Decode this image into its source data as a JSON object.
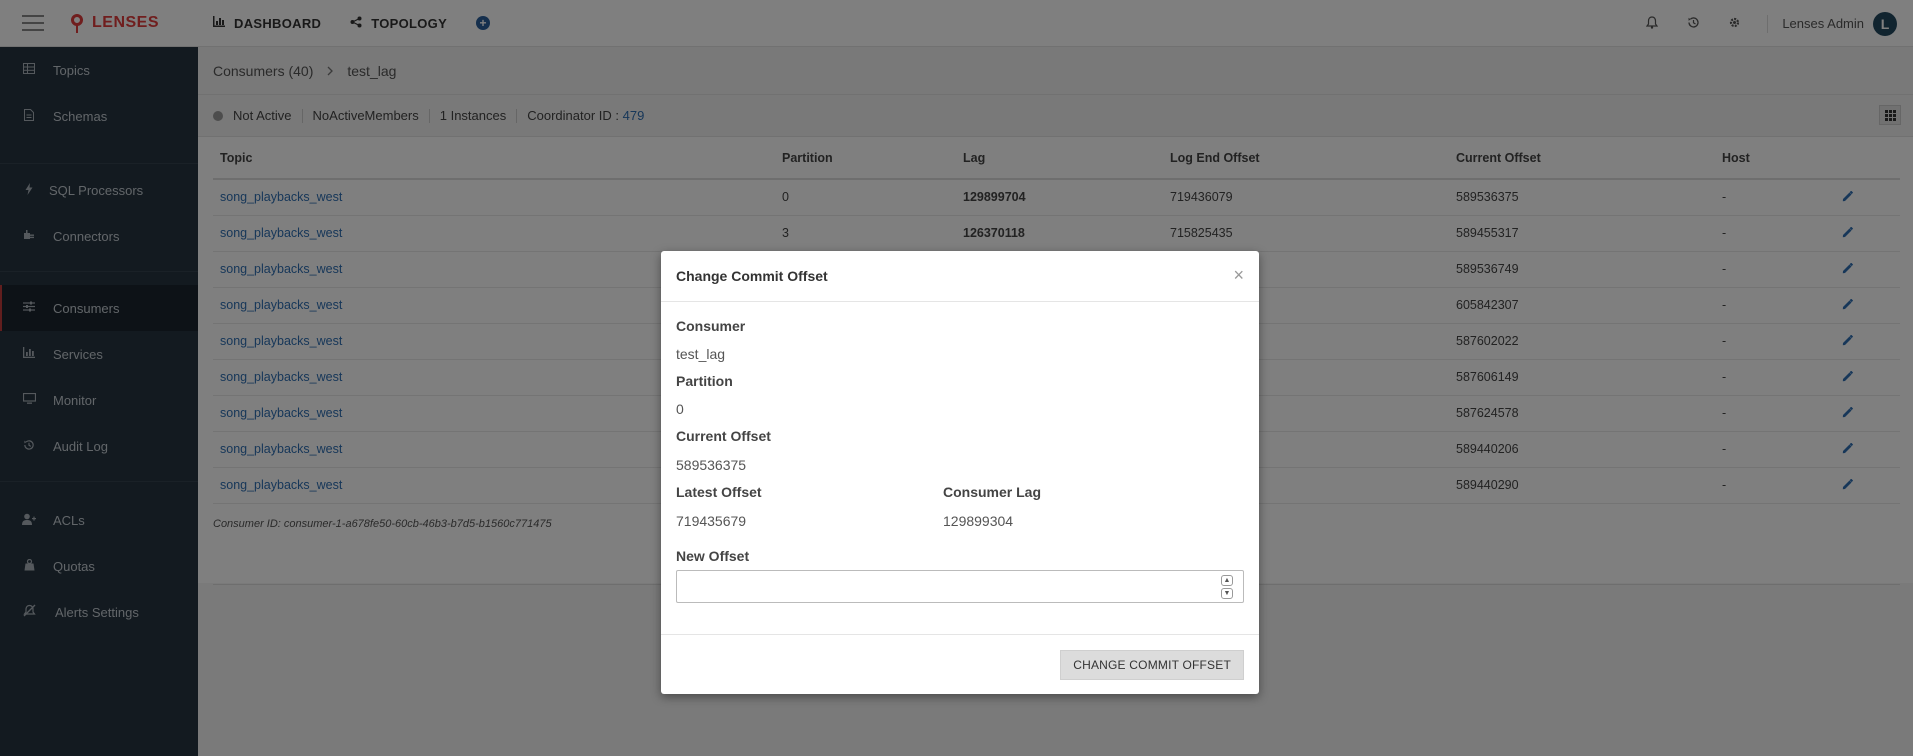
{
  "header": {
    "brand": "LENSES",
    "nav": [
      {
        "label": "DASHBOARD",
        "icon": "bar-chart-icon"
      },
      {
        "label": "TOPOLOGY",
        "icon": "share-icon"
      }
    ],
    "add_symbol": "+",
    "user_name": "Lenses Admin",
    "avatar_letter": "L"
  },
  "sidebar": {
    "items": [
      {
        "label": "Topics",
        "icon": "table-icon"
      },
      {
        "label": "Schemas",
        "icon": "document-icon"
      },
      {
        "label": "SQL Processors",
        "icon": "bolt-icon"
      },
      {
        "label": "Connectors",
        "icon": "plug-icon"
      },
      {
        "label": "Consumers",
        "icon": "sliders-icon",
        "active": true
      },
      {
        "label": "Services",
        "icon": "chart-icon"
      },
      {
        "label": "Monitor",
        "icon": "monitor-icon"
      },
      {
        "label": "Audit Log",
        "icon": "history-icon"
      },
      {
        "label": "ACLs",
        "icon": "user-plus-icon"
      },
      {
        "label": "Quotas",
        "icon": "weight-icon"
      },
      {
        "label": "Alerts Settings",
        "icon": "bell-slash-icon"
      }
    ]
  },
  "breadcrumb": {
    "parent": "Consumers (40)",
    "current": "test_lag"
  },
  "status": {
    "state": "Not Active",
    "members": "NoActiveMembers",
    "instances": "1 Instances",
    "coordinator_label": "Coordinator ID :",
    "coordinator_value": "479"
  },
  "table": {
    "columns": [
      "Topic",
      "Partition",
      "Lag",
      "Log End Offset",
      "Current Offset",
      "Host"
    ],
    "rows": [
      {
        "topic": "song_playbacks_west",
        "partition": "0",
        "lag": "129899704",
        "log_end": "719436079",
        "current": "589536375",
        "host": "-"
      },
      {
        "topic": "song_playbacks_west",
        "partition": "3",
        "lag": "126370118",
        "log_end": "715825435",
        "current": "589455317",
        "host": "-"
      },
      {
        "topic": "song_playbacks_west",
        "partition": "",
        "lag": "",
        "log_end": "",
        "current": "589536749",
        "host": "-"
      },
      {
        "topic": "song_playbacks_west",
        "partition": "",
        "lag": "",
        "log_end": "",
        "current": "605842307",
        "host": "-"
      },
      {
        "topic": "song_playbacks_west",
        "partition": "",
        "lag": "",
        "log_end": "",
        "current": "587602022",
        "host": "-"
      },
      {
        "topic": "song_playbacks_west",
        "partition": "",
        "lag": "",
        "log_end": "",
        "current": "587606149",
        "host": "-"
      },
      {
        "topic": "song_playbacks_west",
        "partition": "",
        "lag": "",
        "log_end": "",
        "current": "587624578",
        "host": "-"
      },
      {
        "topic": "song_playbacks_west",
        "partition": "",
        "lag": "",
        "log_end": "",
        "current": "589440206",
        "host": "-"
      },
      {
        "topic": "song_playbacks_west",
        "partition": "",
        "lag": "",
        "log_end": "",
        "current": "589440290",
        "host": "-"
      }
    ],
    "consumer_id": "Consumer ID: consumer-1-a678fe50-60cb-46b3-b7d5-b1560c771475"
  },
  "modal": {
    "title": "Change Commit Offset",
    "close": "×",
    "consumer_label": "Consumer",
    "consumer_value": "test_lag",
    "partition_label": "Partition",
    "partition_value": "0",
    "current_offset_label": "Current Offset",
    "current_offset_value": "589536375",
    "latest_offset_label": "Latest Offset",
    "latest_offset_value": "719435679",
    "consumer_lag_label": "Consumer Lag",
    "consumer_lag_value": "129899304",
    "new_offset_label": "New Offset",
    "new_offset_value": "",
    "submit_label": "CHANGE COMMIT OFFSET"
  },
  "colors": {
    "brand": "#e03c3c",
    "sidebar_bg": "#263440",
    "link": "#2f6fb3",
    "active_border": "#c23d3d"
  }
}
